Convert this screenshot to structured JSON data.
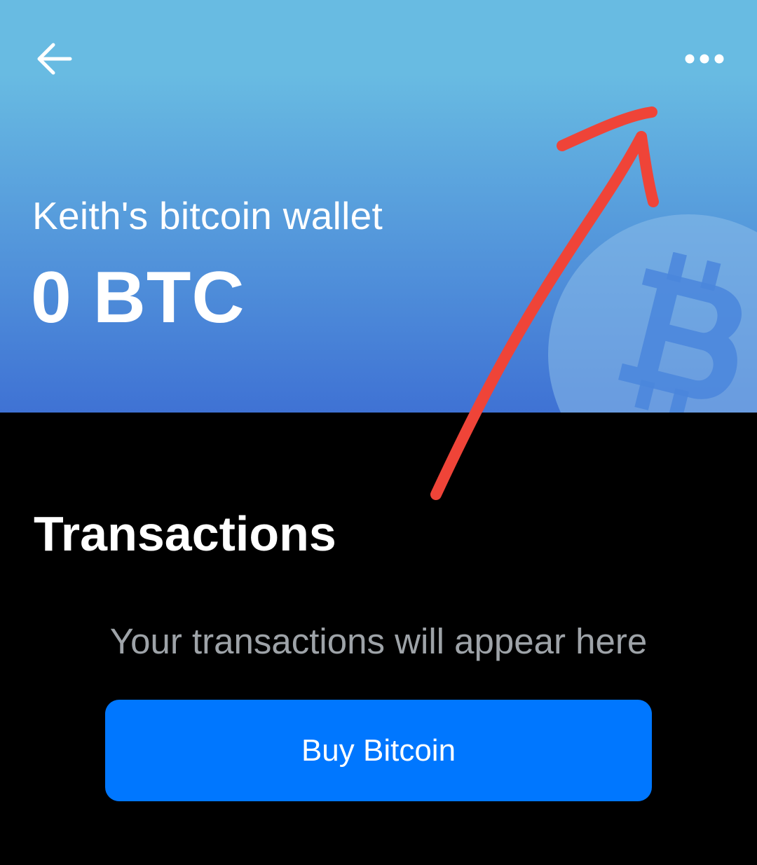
{
  "colors": {
    "header_gradient_top": "#68bbe2",
    "header_gradient_bottom": "#3f72d4",
    "watermark_circle": "#8cbdea",
    "watermark_glyph": "#4a86dc",
    "background": "#000000",
    "button": "#0077ff",
    "annotation_arrow": "#ef4438",
    "muted_text": "#9ea3a8"
  },
  "header": {
    "back_icon": "arrow-left-icon",
    "more_icon": "more-horizontal-icon",
    "wallet_name": "Keith's bitcoin wallet",
    "balance": "0 BTC",
    "watermark_icon": "bitcoin-icon"
  },
  "transactions": {
    "title": "Transactions",
    "empty_message": "Your transactions will appear here",
    "buy_button_label": "Buy Bitcoin"
  },
  "annotation": {
    "type": "hand-drawn-arrow",
    "points_to": "more-button"
  }
}
